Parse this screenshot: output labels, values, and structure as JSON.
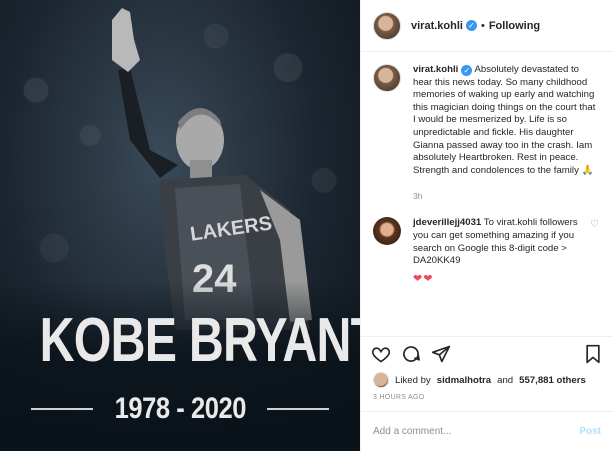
{
  "post": {
    "image": {
      "headline": "KOBE BRYANT",
      "years": "1978 - 2020",
      "jersey_text": "LAKERS",
      "jersey_number": "24"
    },
    "header": {
      "username": "virat.kohli",
      "separator": "•",
      "follow_state": "Following"
    },
    "caption": {
      "username": "virat.kohli",
      "text": "Absolutely devastated to hear this news today. So many childhood memories of waking up early and watching this magician doing things on the court that I would be mesmerized by. Life is so unpredictable and fickle. His daughter Gianna passed away too in the crash. Iam absolutely Heartbroken. Rest in peace. Strength and condolences to the family 🙏",
      "time": "3h"
    },
    "reply": {
      "username": "jdeverillejj4031",
      "text": "To virat.kohli followers you can get something amazing if you search on Google this 8-digit code > DA20KK49",
      "hearts": "❤❤"
    },
    "likes": {
      "prefix": "Liked by",
      "user": "sidmalhotra",
      "mid": "and",
      "count": "557,881 others"
    },
    "timestamp": "3 HOURS AGO",
    "add_comment": {
      "placeholder": "Add a comment...",
      "post_label": "Post"
    },
    "icons": [
      "heart-icon",
      "comment-icon",
      "share-icon",
      "bookmark-icon",
      "verified-icon"
    ]
  }
}
